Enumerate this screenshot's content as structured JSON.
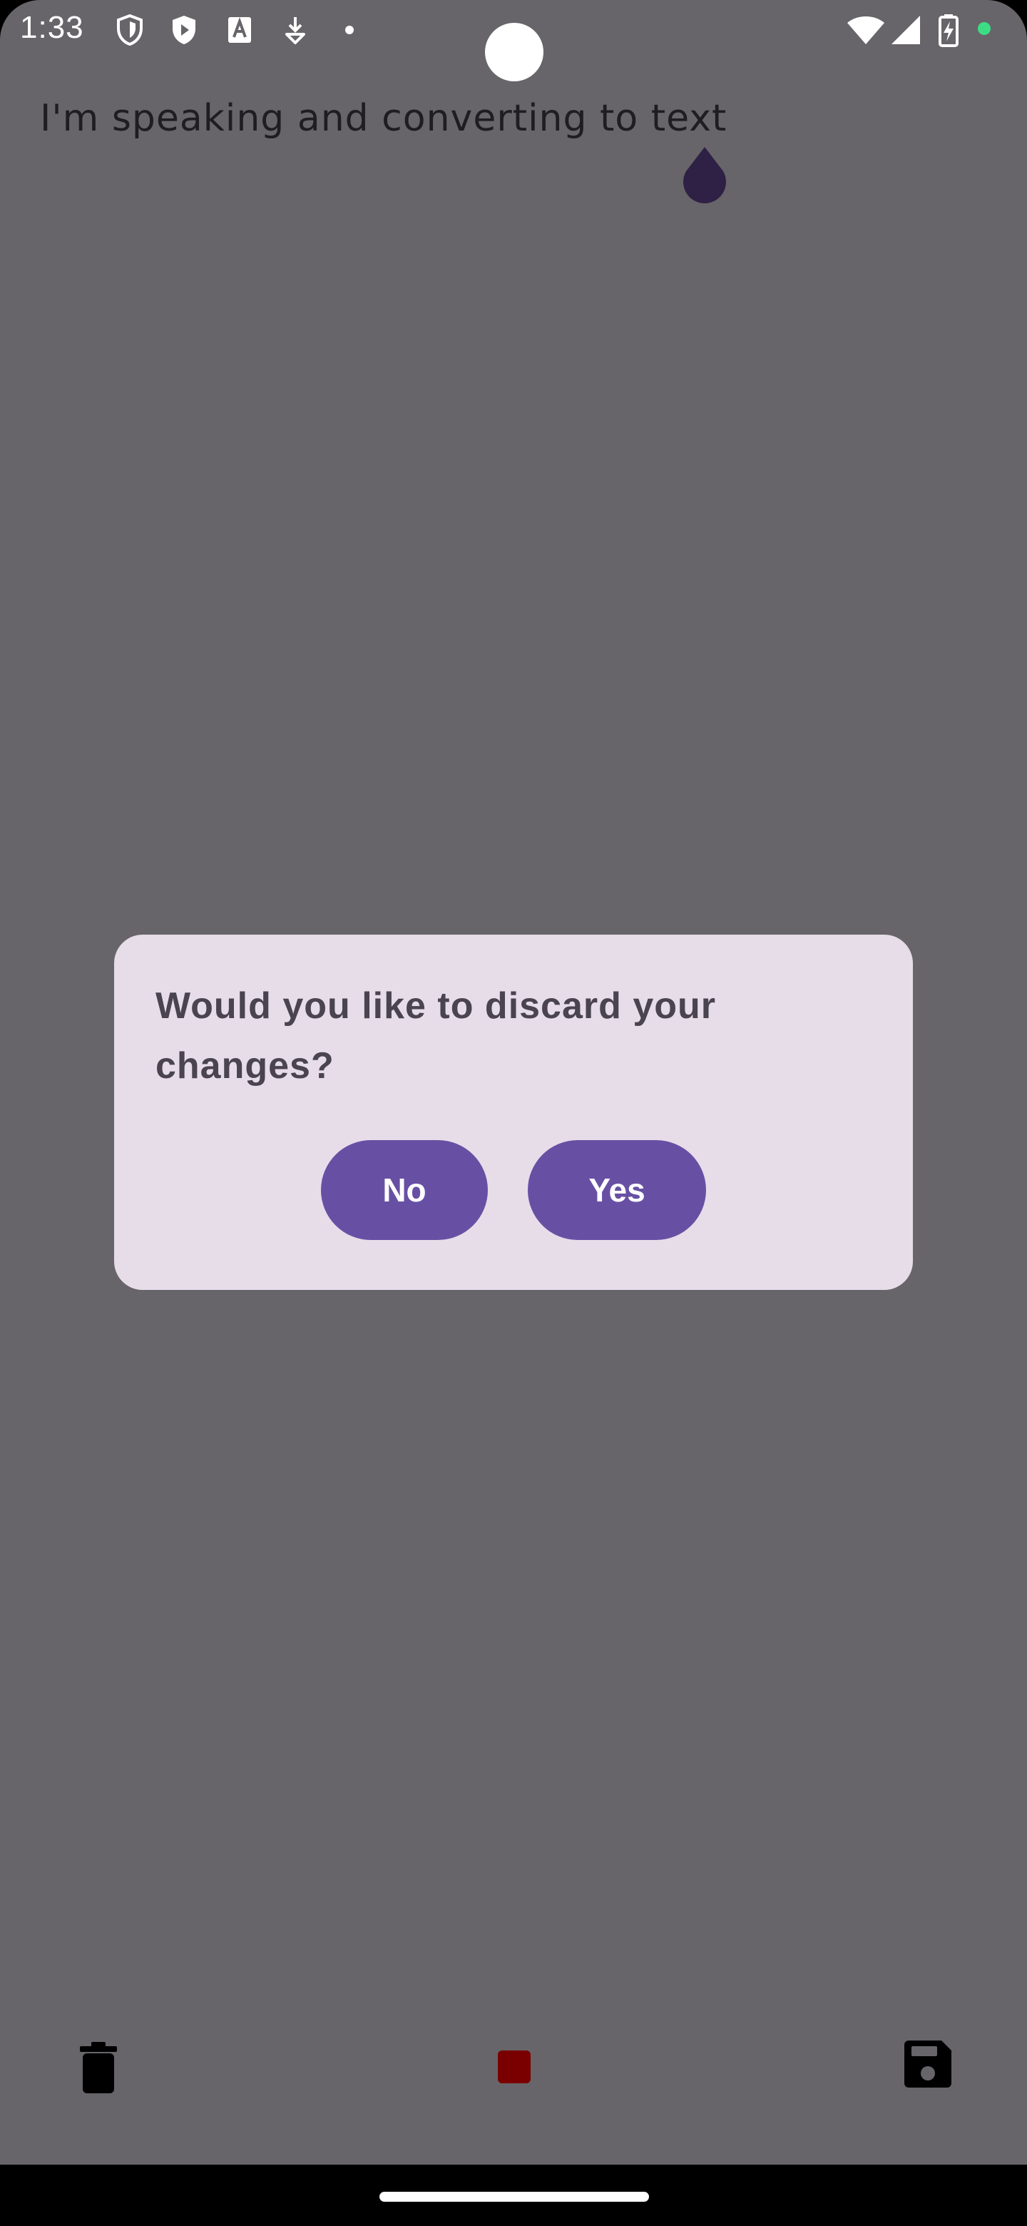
{
  "status_bar": {
    "time": "1:33",
    "left_icons": [
      "shield-icon",
      "shield-play-icon",
      "font-download-icon",
      "download-icon",
      "dot-icon"
    ],
    "right_icons": [
      "wifi-icon",
      "signal-icon",
      "battery-charging-icon",
      "active-dot-icon"
    ],
    "active_dot_color": "#3ddc84"
  },
  "editor": {
    "transcript": "I'm speaking and converting to text"
  },
  "dialog": {
    "title": "Would you like to discard your changes?",
    "no_label": "No",
    "yes_label": "Yes",
    "button_color": "#6750a4",
    "background_color": "#e6dde9"
  },
  "toolbar": {
    "delete_icon": "trash-icon",
    "stop_icon": "stop-icon",
    "stop_color": "#7a0000",
    "save_icon": "save-icon"
  },
  "colors": {
    "scrim": "#676569",
    "cursor_handle": "#2e2145"
  }
}
